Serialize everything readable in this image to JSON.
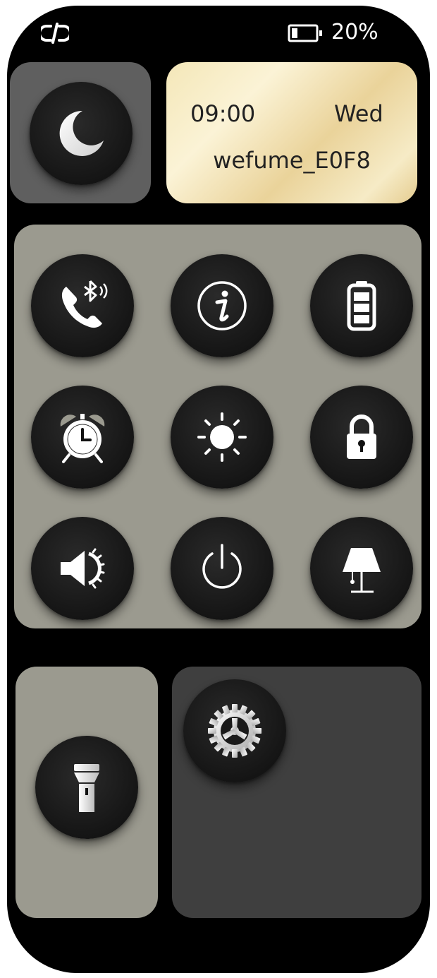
{
  "status_bar": {
    "link_icon": "link-unlink-icon",
    "battery_icon": "battery-low-icon",
    "battery_percent": "20%"
  },
  "top": {
    "moon_icon": "moon-icon",
    "clock": {
      "time": "09:00",
      "day": "Wed",
      "device_name": "wefume_E0F8"
    }
  },
  "grid": {
    "items": [
      {
        "icon": "bluetooth-call-icon"
      },
      {
        "icon": "info-icon"
      },
      {
        "icon": "battery-full-icon"
      },
      {
        "icon": "alarm-clock-icon"
      },
      {
        "icon": "brightness-icon"
      },
      {
        "icon": "lock-icon"
      },
      {
        "icon": "volume-settings-icon"
      },
      {
        "icon": "power-icon"
      },
      {
        "icon": "lamp-icon"
      }
    ]
  },
  "bottom": {
    "flashlight_icon": "flashlight-icon",
    "settings_icon": "gear-icon"
  },
  "colors": {
    "device_bg": "#000000",
    "panel_gray": "#9b9a8f",
    "moon_tile": "#5f5f5f",
    "settings_tile": "#3f3f3f",
    "clock_gold": "#f4e7b8"
  }
}
